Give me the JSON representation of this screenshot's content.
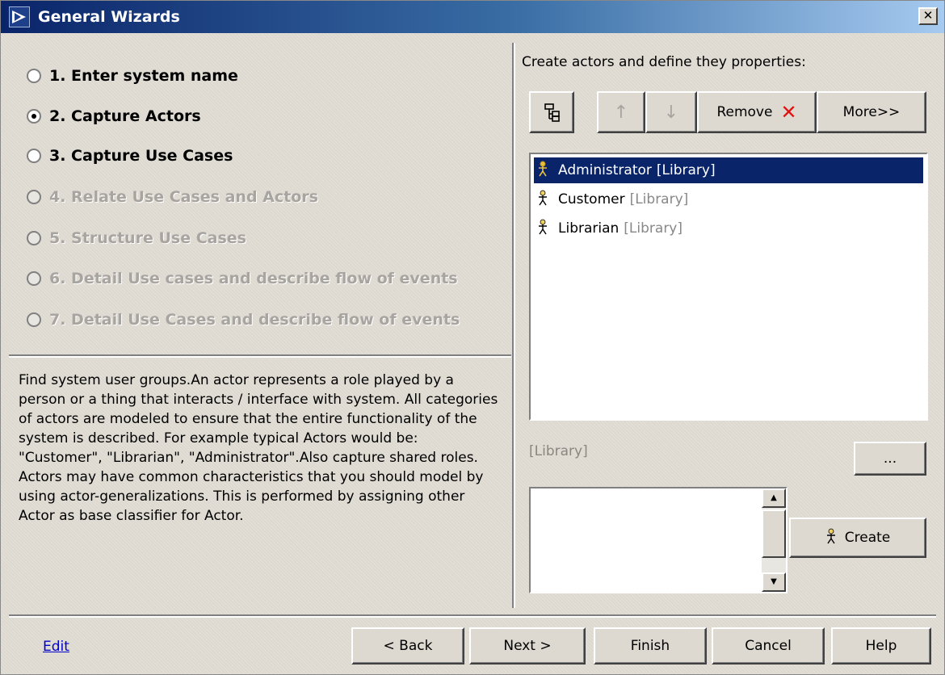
{
  "window": {
    "title": "General Wizards",
    "close_label": "✕"
  },
  "steps": [
    {
      "label": "1. Enter system name",
      "checked": false,
      "enabled": true
    },
    {
      "label": "2. Capture Actors",
      "checked": true,
      "enabled": true
    },
    {
      "label": "3. Capture Use Cases",
      "checked": false,
      "enabled": true
    },
    {
      "label": "4. Relate Use Cases and Actors",
      "checked": false,
      "enabled": false
    },
    {
      "label": "5. Structure Use Cases",
      "checked": false,
      "enabled": false
    },
    {
      "label": "6. Detail Use cases and describe flow of events",
      "checked": false,
      "enabled": false
    },
    {
      "label": "7. Detail Use Cases and describe flow of events",
      "checked": false,
      "enabled": false
    }
  ],
  "description": "Find system user groups.An actor represents a role played by a person or a thing that interacts / interface with system. All categories of actors are modeled to ensure that the entire functionality of the system is described. For example typical Actors would be: \"Customer\", \"Librarian\", \"Administrator\".Also capture shared roles. Actors may have common characteristics that you should model by using actor-generalizations. This is performed by assigning other Actor as base classifier for Actor.",
  "actors_panel": {
    "instruction": "Create actors and define they properties:",
    "toolbar": {
      "tree_icon": "hierarchy-icon",
      "up_label": "↑",
      "down_label": "↓",
      "remove_label": "Remove",
      "remove_icon": "✕",
      "more_label": "More>>"
    },
    "actors": [
      {
        "name": "Administrator",
        "namespace": "[Library]",
        "selected": true
      },
      {
        "name": "Customer",
        "namespace": "[Library]",
        "selected": false
      },
      {
        "name": "Librarian",
        "namespace": "[Library]",
        "selected": false
      }
    ],
    "namespace_label": "[Library]",
    "browse_label": "...",
    "create_label": "Create",
    "new_actor_value": ""
  },
  "footer": {
    "edit_link": "Edit",
    "back_label": "< Back",
    "next_label": "Next >",
    "finish_label": "Finish",
    "cancel_label": "Cancel",
    "help_label": "Help"
  },
  "colors": {
    "title_gradient_start": "#0a246a",
    "title_gradient_end": "#a6caf0",
    "selection": "#0a246a",
    "remove_icon": "#e01010",
    "link": "#0000cc"
  }
}
